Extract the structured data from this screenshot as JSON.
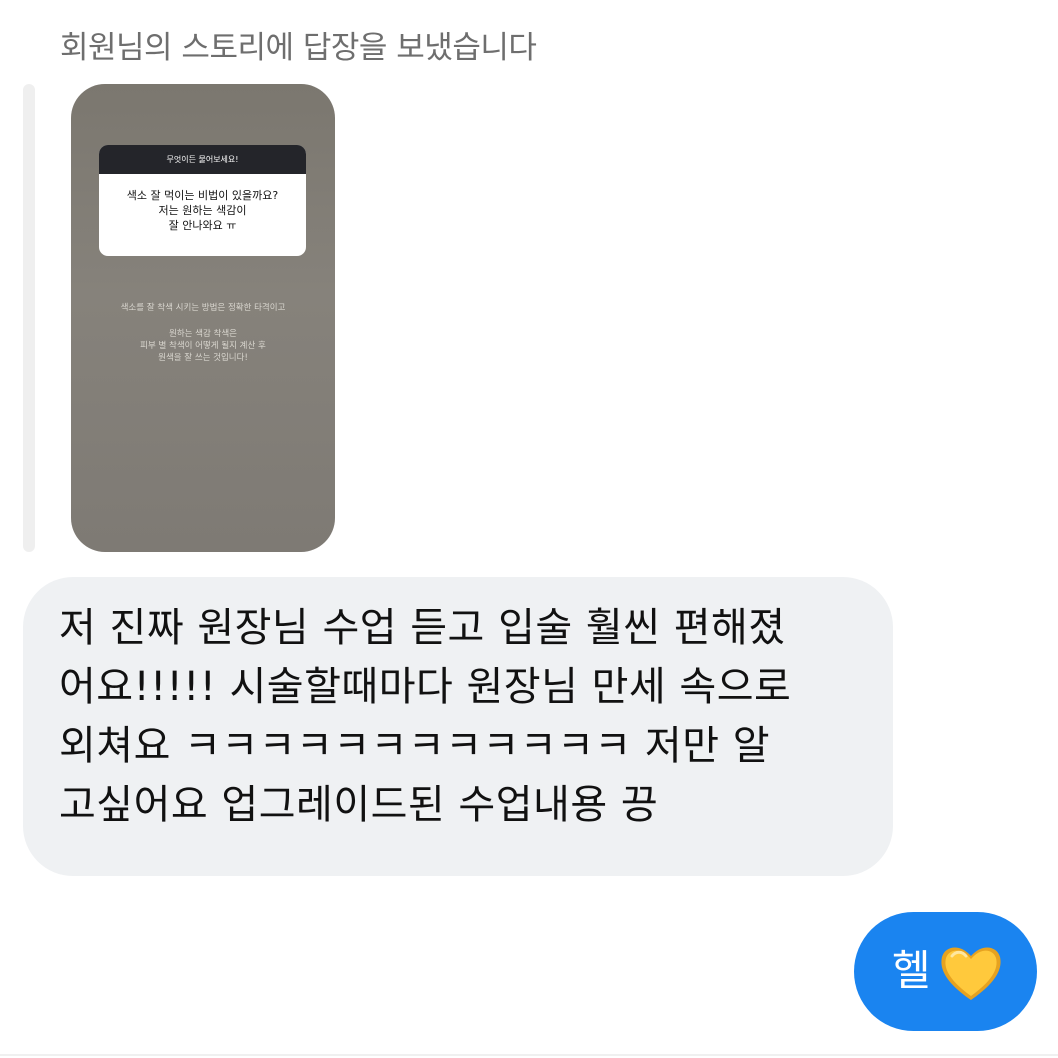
{
  "reply_label": "회원님의 스토리에 답장을 보냈습니다",
  "story": {
    "question_header": "무엇이든 물어보세요!",
    "question_lines": [
      "색소 잘 먹이는 비법이 있을까요?",
      "저는 원하는 색감이",
      "잘 안나와요 ㅠ"
    ],
    "answer_line_1": "색소를 잘 착색 시키는 방법은 정확한 타격이고",
    "answer_lines": [
      "원하는 색감 착색은",
      "피부 별 착색이 어떻게 될지 계산 후",
      "원색을 잘 쓰는 것입니다!"
    ]
  },
  "message": {
    "lines": [
      "저 진짜 원장님 수업 듣고 입술 훨씬 편해졌",
      "어요!!!!! 시술할때마다 원장님 만세 속으로",
      "외쳐요 ㅋㅋㅋㅋㅋㅋㅋㅋㅋㅋㅋㅋ 저만 알",
      "고싶어요 업그레이드된 수업내용 끙"
    ]
  },
  "sent": {
    "text": "헬",
    "emoji_icon": "yellow-heart-icon"
  },
  "colors": {
    "sent_bubble": "#1a84f0",
    "received_bubble": "#eff1f3",
    "heart": "#ffc93c"
  }
}
